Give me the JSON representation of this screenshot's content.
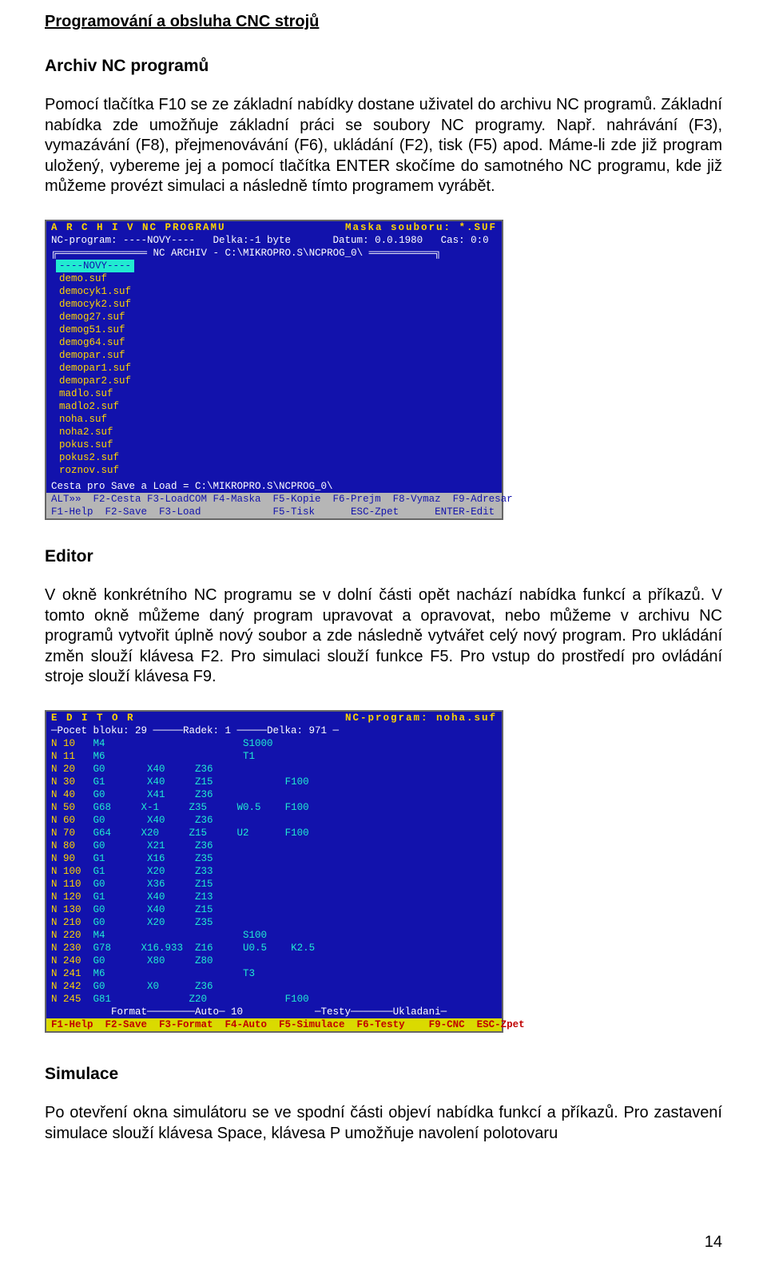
{
  "doc": {
    "title": "Programování a obsluha CNC strojů",
    "page_number": "14"
  },
  "section1": {
    "heading": "Archiv NC programů",
    "paragraph": "Pomocí tlačítka F10 se ze základní nabídky dostane uživatel do archivu NC programů. Základní nabídka zde umožňuje základní práci se soubory NC programy. Např. nahrávání (F3), vymazávání (F8), přejmenovávání (F6), ukládání (F2), tisk (F5) apod. Máme-li zde již program uložený, vybereme jej a pomocí tlačítka ENTER skočíme do samotného NC programu, kde již můžeme provézt simulaci a následně tímto programem vyrábět."
  },
  "archiv_screen": {
    "title_left": "A R C H I V    NC PROGRAMU",
    "title_right": "Maska souboru:  *.SUF",
    "program_row": "NC-program: ----NOVY----   Delka:-1 byte       Datum: 0.0.1980   Cas: 0:0",
    "frame_label": "NC ARCHIV - C:\\MIKROPRO.S\\NCPROG_0\\",
    "files": [
      "----NOVY----",
      "demo.suf",
      "democyk1.suf",
      "democyk2.suf",
      "demog27.suf",
      "demog51.suf",
      "demog64.suf",
      "demopar.suf",
      "demopar1.suf",
      "demopar2.suf",
      "madlo.suf",
      "madlo2.suf",
      "noha.suf",
      "noha2.suf",
      "pokus.suf",
      "pokus2.suf",
      "roznov.suf"
    ],
    "bottom_path": "Cesta pro Save a Load = C:\\MIKROPRO.S\\NCPROG_0\\",
    "fkeys_alt": "ALT»»  F2-Cesta F3-LoadCOM F4-Maska  F5-Kopie  F6-Prejm  F8-Vymaz  F9-Adresar",
    "fkeys_main": "F1-Help  F2-Save  F3-Load            F5-Tisk      ESC-Zpet      ENTER-Edit"
  },
  "section2": {
    "heading": "Editor",
    "paragraph": "V okně konkrétního NC programu se v dolní části opět nachází nabídka funkcí a příkazů. V tomto okně můžeme daný program upravovat a opravovat, nebo můžeme v archivu NC programů vytvořit úplně nový soubor a zde následně vytvářet celý nový program. Pro ukládání změn slouží klávesa F2. Pro simulaci slouží funkce F5. Pro vstup do prostředí pro ovládání stroje slouží klávesa F9."
  },
  "editor_screen": {
    "title_left": "E D I T O R",
    "title_right": "NC-program: noha.suf",
    "status_row": "─Pocet bloku: 29 ─────Radek: 1 ─────Delka: 971 ─",
    "lines": [
      {
        "n": "N 10 ",
        "code": "M4",
        "args": "                     S1000"
      },
      {
        "n": "N 11 ",
        "code": "M6",
        "args": "                     T1"
      },
      {
        "n": "N 20 ",
        "code": "G0",
        "args": "     X40     Z36"
      },
      {
        "n": "N 30 ",
        "code": "G1",
        "args": "     X40     Z15            F100"
      },
      {
        "n": "N 40 ",
        "code": "G0",
        "args": "     X41     Z36"
      },
      {
        "n": "N 50 ",
        "code": "G68",
        "args": "    X-1     Z35     W0.5    F100"
      },
      {
        "n": "N 60 ",
        "code": "G0",
        "args": "     X40     Z36"
      },
      {
        "n": "N 70 ",
        "code": "G64",
        "args": "    X20     Z15     U2      F100"
      },
      {
        "n": "N 80 ",
        "code": "G0",
        "args": "     X21     Z36"
      },
      {
        "n": "N 90 ",
        "code": "G1",
        "args": "     X16     Z35"
      },
      {
        "n": "N 100",
        "code": "G1",
        "args": "     X20     Z33"
      },
      {
        "n": "N 110",
        "code": "G0",
        "args": "     X36     Z15"
      },
      {
        "n": "N 120",
        "code": "G1",
        "args": "     X40     Z13"
      },
      {
        "n": "N 130",
        "code": "G0",
        "args": "     X40     Z15"
      },
      {
        "n": "N 210",
        "code": "G0",
        "args": "     X20     Z35"
      },
      {
        "n": "N 220",
        "code": "M4",
        "args": "                     S100"
      },
      {
        "n": "N 230",
        "code": "G78",
        "args": "    X16.933  Z16     U0.5    K2.5"
      },
      {
        "n": "N 240",
        "code": "G0",
        "args": "     X80     Z80"
      },
      {
        "n": "N 241",
        "code": "M6",
        "args": "                     T3"
      },
      {
        "n": "N 242",
        "code": "G0",
        "args": "     X0      Z36"
      },
      {
        "n": "N 245",
        "code": "G81",
        "args": "            Z20             F100"
      }
    ],
    "footer_row": "          Format────────Auto─ 10            ─Testy───────Ukladani─",
    "fkeys": "F1-Help  F2-Save  F3-Format  F4-Auto  F5-Simulace  F6-Testy    F9-CNC  ESC-Zpet"
  },
  "section3": {
    "heading": "Simulace",
    "paragraph": "Po otevření okna simulátoru se ve spodní části objeví nabídka funkcí a příkazů. Pro zastavení simulace slouží klávesa Space, klávesa P umožňuje navolení polotovaru"
  }
}
